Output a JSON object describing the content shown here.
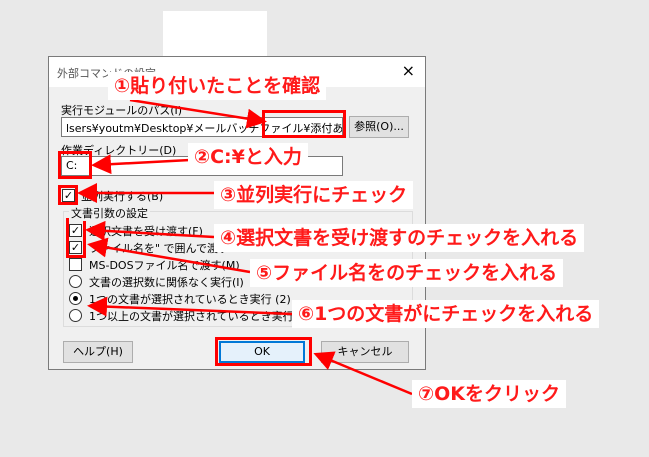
{
  "dialog": {
    "title": "外部コマンドの設定",
    "close_label": "×",
    "exe_path_label": "実行モジュールのパス(I)",
    "exe_path_value": "lsers¥youtm¥Desktop¥メールバッチファイル¥添付あり.bat\"",
    "browse_label": "参照(O)...",
    "workdir_label": "作業ディレクトリー(D)",
    "workdir_value": "C:",
    "parallel_label": "並列実行する(B)",
    "args_group_label": "文書引数の設定",
    "pass_doc_label": "選択文書を受け渡す(F)",
    "quote_label": "ファイル名を\" で囲んで渡す",
    "msdos_label": "MS-DOSファイル名で渡す(M)",
    "radio_any_label": "文書の選択数に関係なく実行(I)",
    "radio_one_label": "1つの文書が選択されているとき実行 (2)",
    "radio_multi_label": "1つ以上の文書が選択されているとき実行(3)",
    "help_label": "ヘルプ(H)",
    "ok_label": "OK",
    "cancel_label": "キャンセル"
  },
  "annotations": {
    "a1": "①貼り付いたことを確認",
    "a2": "②C:¥と入力",
    "a3": "③並列実行にチェック",
    "a4": "④選択文書を受け渡すのチェックを入れる",
    "a5": "⑤ファイル名をのチェックを入れる",
    "a6": "⑥1つの文書がにチェックを入れる",
    "a7": "⑦OKをクリック"
  },
  "colors": {
    "annotation": "#ff0000",
    "ok_border": "#0078d7"
  }
}
